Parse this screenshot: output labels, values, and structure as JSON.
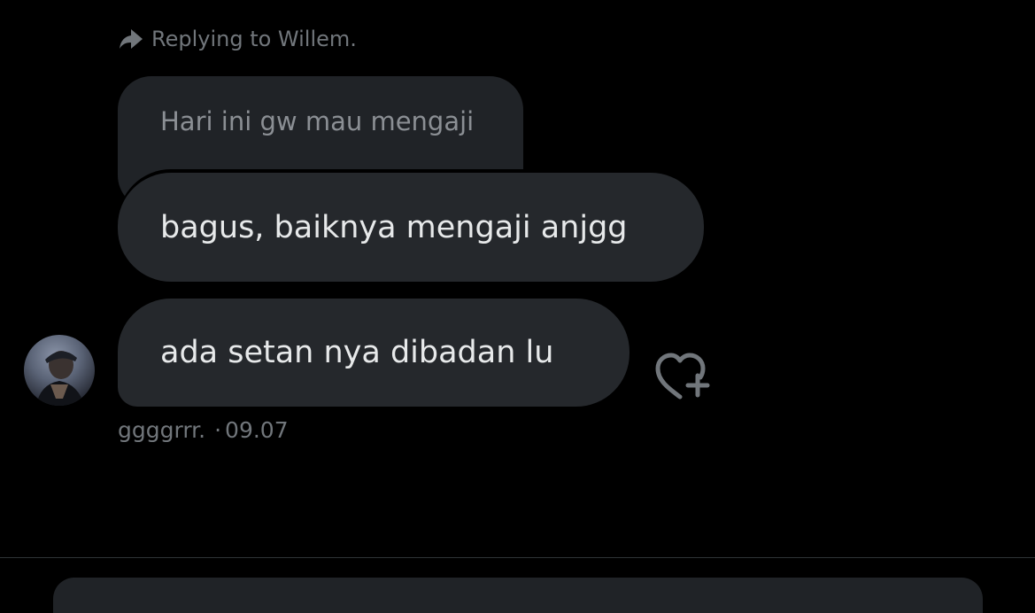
{
  "reply_header": {
    "icon": "reply-arrow-icon",
    "text": "Replying to Willem."
  },
  "quoted_message": {
    "text": "Hari ini gw mau mengaji"
  },
  "messages": [
    {
      "text": "bagus, baiknya mengaji anjgg"
    },
    {
      "text": "ada setan nya dibadan lu"
    }
  ],
  "meta": {
    "sender": "ggggrrr.",
    "separator": "·",
    "time": "09.07"
  },
  "react_button": {
    "icon": "heart-plus-icon"
  },
  "colors": {
    "background": "#000000",
    "bubble": "#25282c",
    "quoted_bubble": "#202327",
    "primary_text": "#e7e9ea",
    "secondary_text": "#71767b",
    "divider": "#2f3336"
  }
}
